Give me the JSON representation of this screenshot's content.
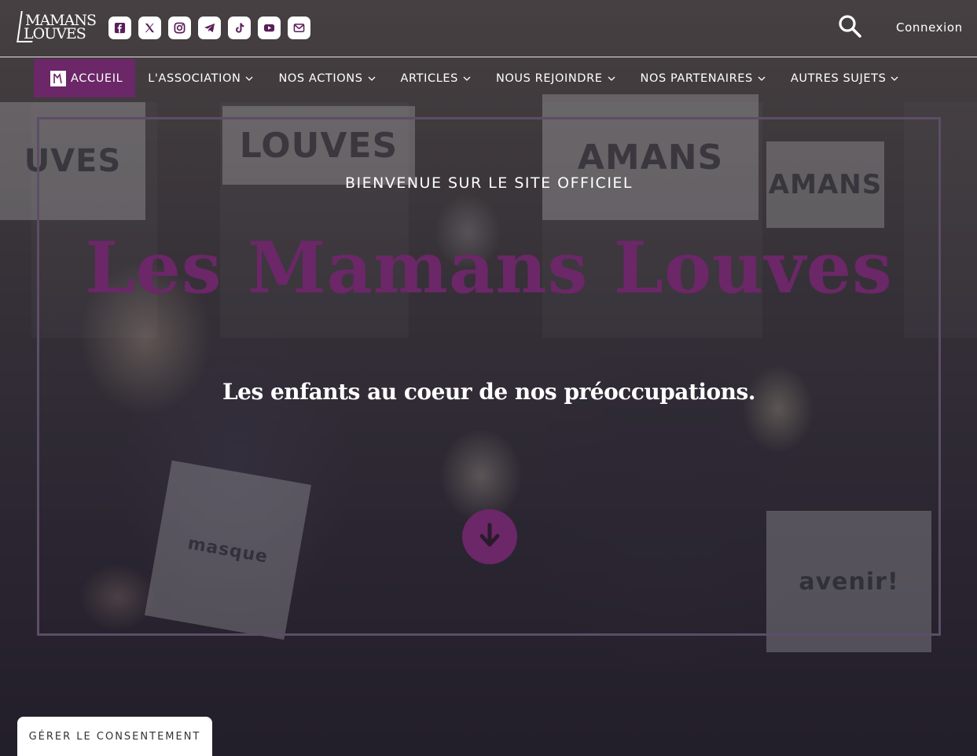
{
  "logo": {
    "line1": "MAMANS",
    "line2": "LOUVES"
  },
  "socials": [
    {
      "icon": "facebook-icon",
      "glyph": "f"
    },
    {
      "icon": "x-twitter-icon",
      "glyph": "𝕏"
    },
    {
      "icon": "instagram-icon",
      "glyph": "◎"
    },
    {
      "icon": "telegram-icon",
      "glyph": "➤"
    },
    {
      "icon": "tiktok-icon",
      "glyph": "♪"
    },
    {
      "icon": "youtube-icon",
      "glyph": "▶"
    },
    {
      "icon": "email-icon",
      "glyph": "✉"
    }
  ],
  "header": {
    "login_label": "Connexion"
  },
  "nav": {
    "home": "ACCUEIL",
    "association": "L'ASSOCIATION",
    "actions": "NOS ACTIONS",
    "articles": "ARTICLES",
    "join": "NOUS REJOINDRE",
    "partners": "NOS PARTENAIRES",
    "other": "AUTRES SUJETS"
  },
  "hero": {
    "kicker": "BIENVENUE SUR LE SITE OFFICIEL",
    "title": "Les Mamans Louves",
    "subtitle": "Les enfants au coeur de nos préoccupations."
  },
  "consent": {
    "label": "GÉRER LE CONSENTEMENT"
  },
  "colors": {
    "brand": "#6b2767",
    "frame": "#5d4d67"
  }
}
